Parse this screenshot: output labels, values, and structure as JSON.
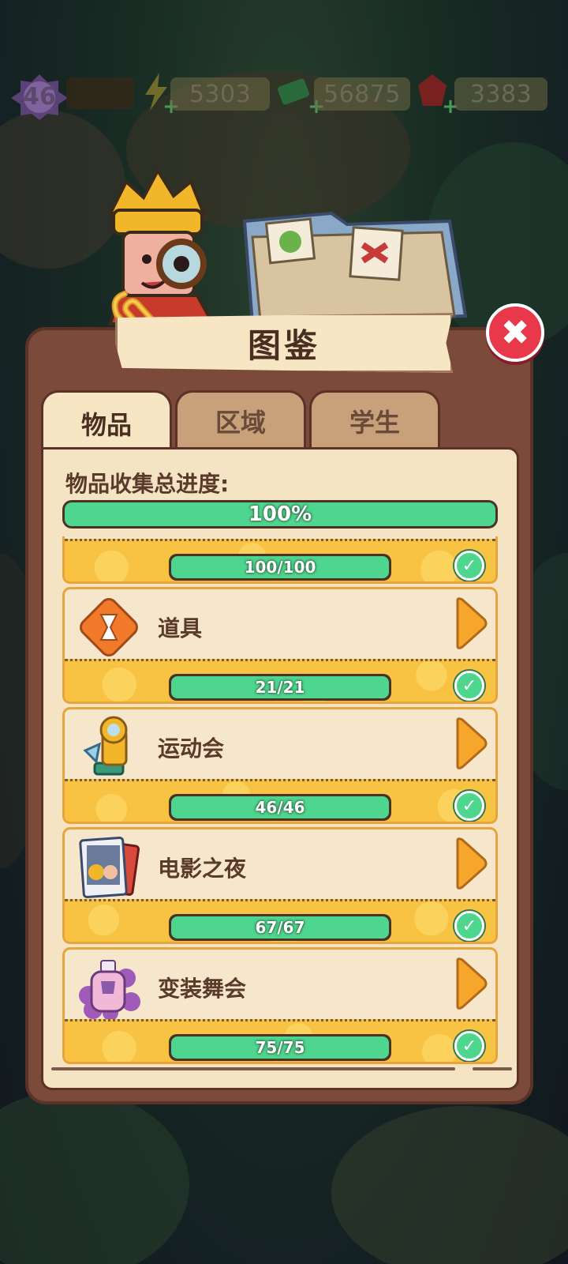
{
  "resources": {
    "level": "46",
    "energy": "5303",
    "cash": "56875",
    "gems": "3383"
  },
  "dialog": {
    "title": "图鉴",
    "close_label": "✖"
  },
  "tabs": [
    {
      "label": "物品",
      "active": true
    },
    {
      "label": "区域",
      "active": false
    },
    {
      "label": "学生",
      "active": false
    }
  ],
  "collection": {
    "total_label": "物品收集总进度:",
    "total_percent_text": "100%",
    "total_fraction": 1.0
  },
  "categories": [
    {
      "name": "",
      "progress_text": "100/100",
      "fraction": 1.0,
      "icon": "hidden",
      "complete": true
    },
    {
      "name": "道具",
      "progress_text": "21/21",
      "fraction": 1.0,
      "icon": "hourglass-icon",
      "complete": true
    },
    {
      "name": "运动会",
      "progress_text": "46/46",
      "fraction": 1.0,
      "icon": "trophy-cannon-icon",
      "complete": true
    },
    {
      "name": "电影之夜",
      "progress_text": "67/67",
      "fraction": 1.0,
      "icon": "movie-poster-icon",
      "complete": true
    },
    {
      "name": "变装舞会",
      "progress_text": "75/75",
      "fraction": 1.0,
      "icon": "perfume-bottle-icon",
      "complete": true
    }
  ],
  "colors": {
    "progress_fill": "#4fd68e",
    "card_border": "#e8a43a",
    "close_button": "#e8384a",
    "panel": "#7b4a3a"
  }
}
